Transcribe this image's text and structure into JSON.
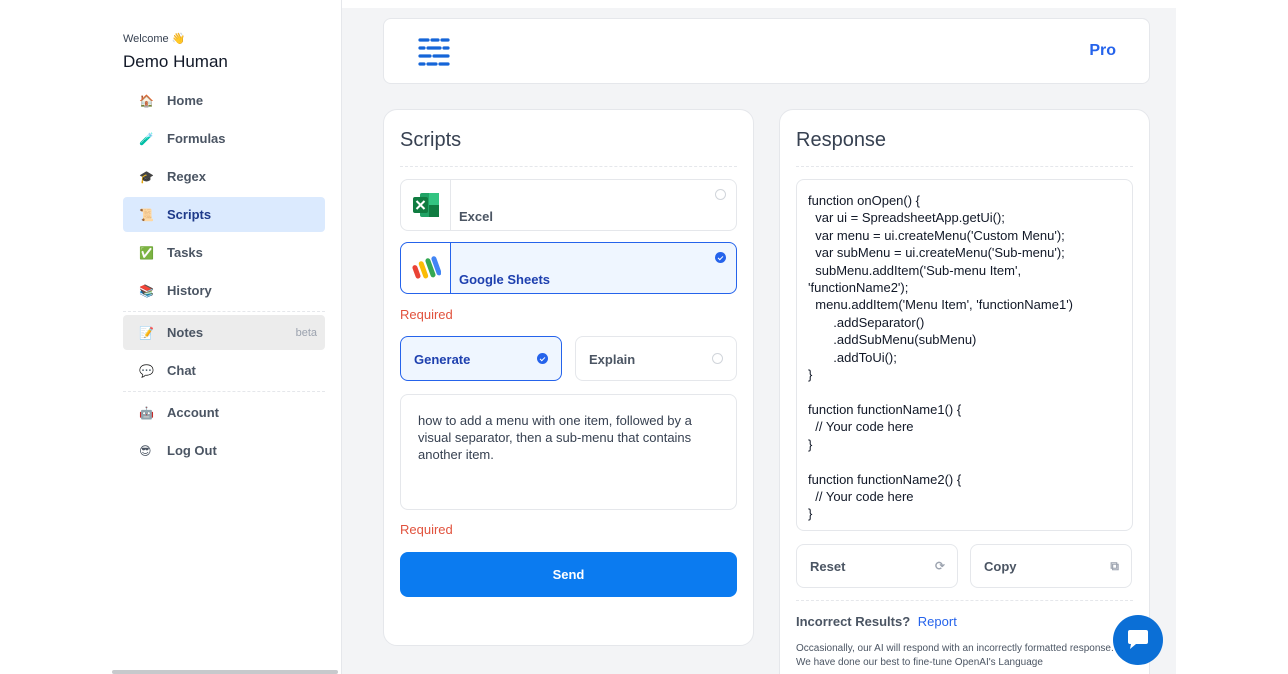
{
  "sidebar": {
    "welcome": "Welcome 👋",
    "user_name": "Demo Human",
    "items": [
      {
        "emoji": "🏠",
        "label": "Home"
      },
      {
        "emoji": "🧪",
        "label": "Formulas"
      },
      {
        "emoji": "🎓",
        "label": "Regex"
      },
      {
        "emoji": "📜",
        "label": "Scripts"
      },
      {
        "emoji": "✅",
        "label": "Tasks"
      },
      {
        "emoji": "📚",
        "label": "History"
      },
      {
        "emoji": "📝",
        "label": "Notes",
        "badge": "beta"
      },
      {
        "emoji": "💬",
        "label": "Chat"
      },
      {
        "emoji": "🤖",
        "label": "Account"
      },
      {
        "emoji": "😎",
        "label": "Log Out"
      }
    ]
  },
  "header": {
    "plan": "Pro"
  },
  "scripts": {
    "title": "Scripts",
    "options": [
      {
        "label": "Excel",
        "selected": false
      },
      {
        "label": "Google Sheets",
        "selected": true
      }
    ],
    "required_1": "Required",
    "modes": [
      {
        "label": "Generate",
        "selected": true
      },
      {
        "label": "Explain",
        "selected": false
      }
    ],
    "prompt_value": "how to add a menu with one item, followed by a visual separator, then a sub-menu that contains another item.",
    "required_2": "Required",
    "send_label": "Send"
  },
  "response": {
    "title": "Response",
    "code": "function onOpen() {\n  var ui = SpreadsheetApp.getUi();\n  var menu = ui.createMenu('Custom Menu');\n  var subMenu = ui.createMenu('Sub-menu');\n  subMenu.addItem('Sub-menu Item', 'functionName2');\n  menu.addItem('Menu Item', 'functionName1')\n       .addSeparator()\n       .addSubMenu(subMenu)\n       .addToUi();\n}\n\nfunction functionName1() {\n  // Your code here\n}\n\nfunction functionName2() {\n  // Your code here\n}",
    "reset_label": "Reset",
    "copy_label": "Copy",
    "incorrect_label": "Incorrect Results?",
    "report_label": "Report",
    "note": "Occasionally, our AI will respond with an incorrectly formatted response. We have done our best to fine-tune OpenAI's  Language"
  },
  "colors": {
    "accent": "#0b7bf0",
    "required": "#e1523d",
    "active_nav": "#dbeafe"
  }
}
